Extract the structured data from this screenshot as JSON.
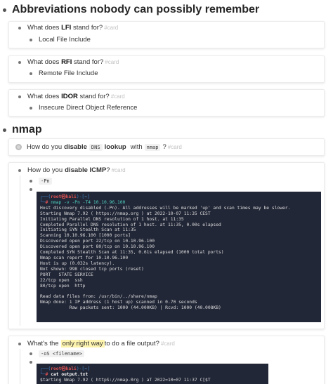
{
  "sections": [
    {
      "title": "Abbreviations nobody can possibly remember",
      "cards": [
        {
          "q_prefix": "What does ",
          "q_bold": "LFI",
          "q_suffix": " stand for?",
          "tag": "#card",
          "answer": "Local File Include"
        },
        {
          "q_prefix": "What does ",
          "q_bold": "RFI",
          "q_suffix": " stand for?",
          "tag": "#card",
          "answer": "Remote File Include"
        },
        {
          "q_prefix": "What does ",
          "q_bold": "IDOR",
          "q_suffix": " stand for?",
          "tag": "#card",
          "answer": "Insecure Direct Object Reference"
        }
      ]
    },
    {
      "title": "nmap",
      "card_dns": {
        "p1": "How do you ",
        "b1": "disable",
        "code1": "DNS",
        "b2": "lookup",
        "p2": "with",
        "code2": "nmap",
        "p3": "?",
        "tag": "#card"
      },
      "card_icmp": {
        "p1": "How do you ",
        "b1": "disable ICMP",
        "p2": "?",
        "tag": "#card",
        "answer_code": "-Pn"
      },
      "card_output": {
        "p1": "What's the ",
        "hl": "only right way",
        "p2": " to do a file output?",
        "tag": "#card",
        "answer_code": "-oS <filename>"
      }
    }
  ],
  "terminal1": {
    "prompt_open": "┌──(",
    "user": "root㉿kali",
    "prompt_mid": ")-[",
    "cwd": "~",
    "prompt_close": "]",
    "prompt2": "└─",
    "hash": "# ",
    "command": "nmap -v -Pn -T4 10.10.96.100",
    "output": [
      "Host discovery disabled (-Pn). All addresses will be marked 'up' and scan times may be slower.",
      "Starting Nmap 7.92 ( https://nmap.org ) at 2022-10-07 11:35 CEST",
      "Initiating Parallel DNS resolution of 1 host. at 11:35",
      "Completed Parallel DNS resolution of 1 host. at 11:35, 0.00s elapsed",
      "Initiating SYN Stealth Scan at 11:35",
      "Scanning 10.10.96.100 [1000 ports]",
      "Discovered open port 22/tcp on 10.10.96.100",
      "Discovered open port 80/tcp on 10.10.96.100",
      "Completed SYN Stealth Scan at 11:35, 0.61s elapsed (1000 total ports)",
      "Nmap scan report for 10.10.96.100",
      "Host is up (0.032s latency).",
      "Not shown: 998 closed tcp ports (reset)",
      "PORT   STATE SERVICE",
      "22/tcp open  ssh",
      "80/tcp open  http",
      "",
      "Read data files from: /usr/bin/../share/nmap",
      "Nmap done: 1 IP address (1 host up) scanned in 0.70 seconds",
      "           Raw packets sent: 1000 (44.000KB) | Rcvd: 1000 (40.008KB)"
    ]
  },
  "terminal2": {
    "prompt_open": "┌──(",
    "user": "root㉿kali",
    "prompt_mid": ")-[",
    "cwd": "~",
    "prompt_close": "]",
    "prompt2": "└─",
    "hash": "# ",
    "command": "cat output.txt",
    "output_partial": "$tarting Nmap 7.92 ( httpS://nmap.0rg ) aT 2022=10=07 11:37 C[$T"
  }
}
